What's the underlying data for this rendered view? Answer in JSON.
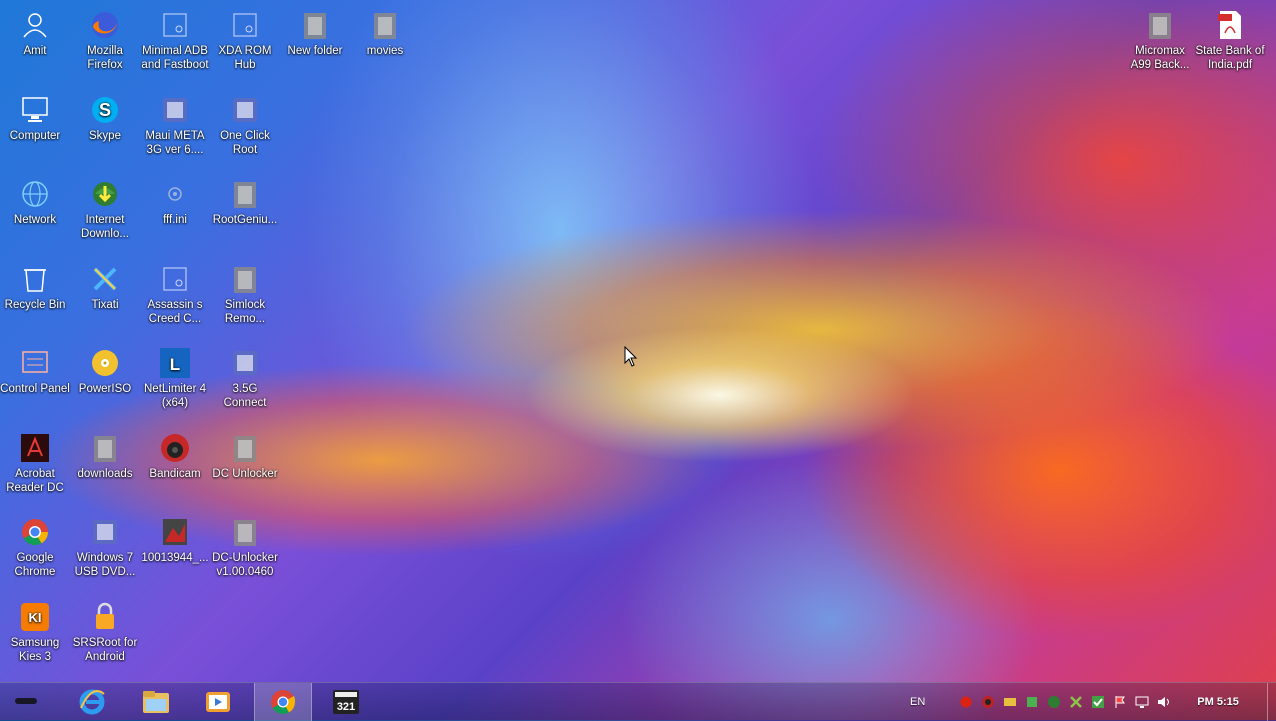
{
  "desktop": {
    "icons_left": [
      {
        "label": "Amit",
        "icon": "user-folder-icon"
      },
      {
        "label": "Mozilla Firefox",
        "icon": "firefox-icon"
      },
      {
        "label": "Minimal ADB and Fastboot",
        "icon": "shortcut-icon"
      },
      {
        "label": "XDA ROM Hub",
        "icon": "shortcut-icon"
      },
      {
        "label": "New folder",
        "icon": "folder-icon"
      },
      {
        "label": "movies",
        "icon": "folder-icon"
      },
      {
        "label": "Computer",
        "icon": "computer-icon"
      },
      {
        "label": "Skype",
        "icon": "skype-icon"
      },
      {
        "label": "Maui META 3G ver 6....",
        "icon": "app-icon"
      },
      {
        "label": "One Click Root",
        "icon": "app-icon"
      },
      {
        "label": "Network",
        "icon": "network-icon"
      },
      {
        "label": "Internet Downlo...",
        "icon": "idm-icon"
      },
      {
        "label": "fff.ini",
        "icon": "settings-file-icon"
      },
      {
        "label": "RootGeniu...",
        "icon": "folder-icon"
      },
      {
        "label": "Recycle Bin",
        "icon": "recycle-bin-icon"
      },
      {
        "label": "Tixati",
        "icon": "tixati-icon"
      },
      {
        "label": "Assassin s Creed C...",
        "icon": "shortcut-icon"
      },
      {
        "label": "Simlock Remo...",
        "icon": "folder-icon"
      },
      {
        "label": "Control Panel",
        "icon": "control-panel-icon"
      },
      {
        "label": "PowerISO",
        "icon": "poweriso-icon"
      },
      {
        "label": "NetLimiter 4 (x64)",
        "icon": "netlimiter-icon"
      },
      {
        "label": "3.5G Connect",
        "icon": "app-icon"
      },
      {
        "label": "Acrobat Reader DC",
        "icon": "acrobat-icon"
      },
      {
        "label": "downloads",
        "icon": "folder-icon"
      },
      {
        "label": "Bandicam",
        "icon": "bandicam-icon"
      },
      {
        "label": "DC Unlocker",
        "icon": "folder-icon"
      },
      {
        "label": "Google Chrome",
        "icon": "chrome-icon"
      },
      {
        "label": "Windows 7 USB DVD...",
        "icon": "app-icon"
      },
      {
        "label": "10013944_...",
        "icon": "image-file-icon"
      },
      {
        "label": "DC-Unlocker v1.00.0460",
        "icon": "folder-icon"
      },
      {
        "label": "Samsung Kies 3",
        "icon": "kies-icon"
      },
      {
        "label": "SRSRoot for Android",
        "icon": "srsroot-icon"
      }
    ],
    "icons_right": [
      {
        "label": "Micromax A99 Back...",
        "icon": "folder-icon"
      },
      {
        "label": "State Bank of India.pdf",
        "icon": "pdf-icon"
      }
    ]
  },
  "taskbar": {
    "pinned": [
      {
        "name": "internet-explorer-icon"
      },
      {
        "name": "file-explorer-icon"
      },
      {
        "name": "media-player-icon"
      },
      {
        "name": "chrome-icon",
        "active": true
      },
      {
        "name": "media-player-classic-icon",
        "badge": "321"
      }
    ],
    "language": "EN",
    "clock": "PM 5:15",
    "colors": {
      "accent": "#1e88e5"
    }
  }
}
